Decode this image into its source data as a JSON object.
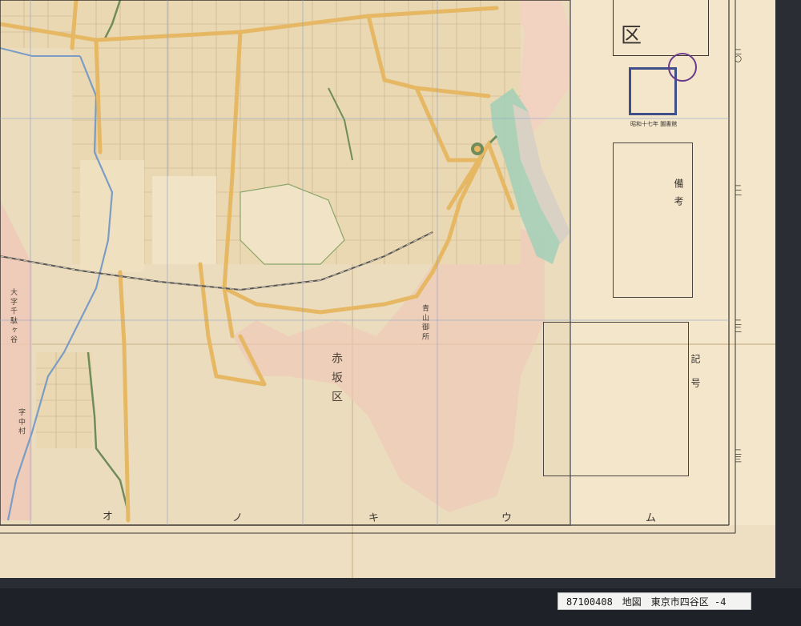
{
  "map": {
    "sheet_title_fragment": "区",
    "district_label": "赤坂区",
    "notes_title": "備考",
    "legend_title": "記号",
    "grid_labels_bottom": [
      "オ",
      "ノ",
      "キ",
      "ウ",
      "ム"
    ],
    "grid_labels_right": [
      "二〇",
      "二一",
      "二二",
      "二三"
    ],
    "road_labels": [
      "字 中 村",
      "大 字 千 駄 ヶ 谷",
      "青 山 御 所"
    ],
    "colors": {
      "paper": "#ecdcbe",
      "road_yellow": "#e6b864",
      "pink_zone": "#f0c7b9",
      "green_line": "#6f8c5a",
      "blue_river": "#7b9cc4",
      "water_park": "#9ed0b8",
      "grid_line": "#8ea6c8"
    }
  },
  "stamp": {
    "label": "昭和十七年 圖書館"
  },
  "caption": {
    "text": "87100408　地図　東京市四谷区 -4"
  }
}
